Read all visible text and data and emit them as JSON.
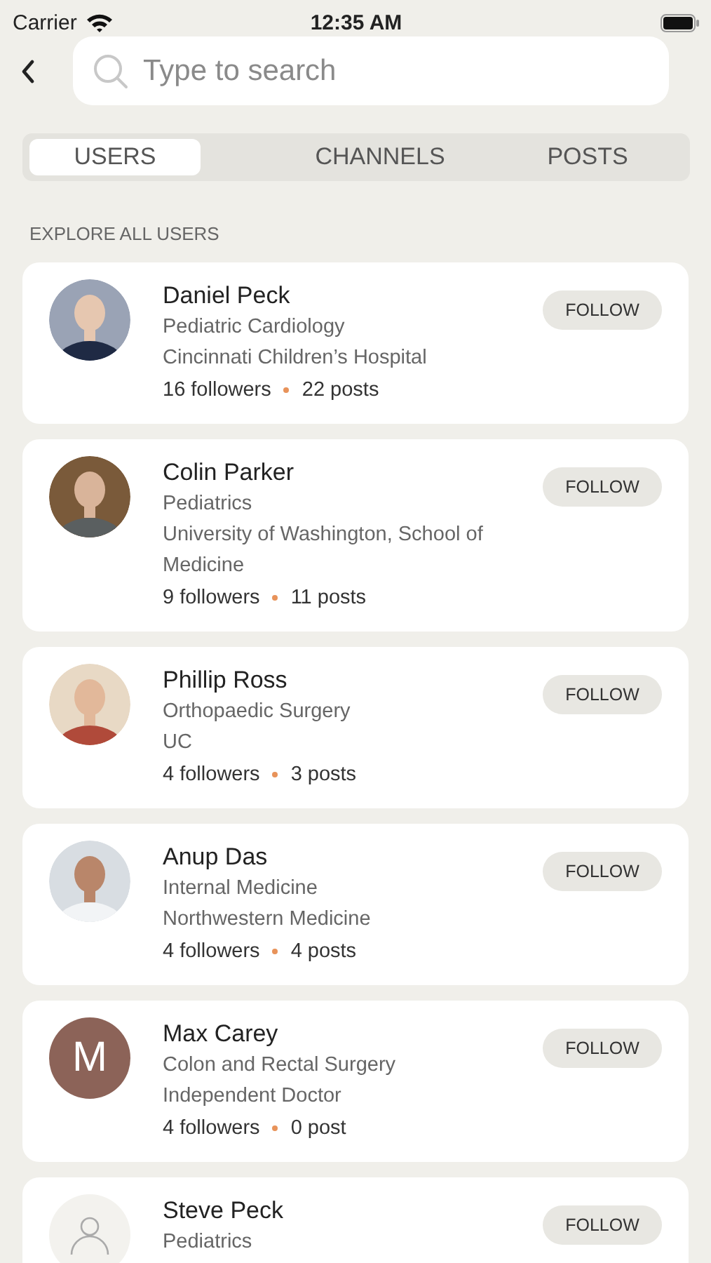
{
  "status_bar": {
    "carrier": "Carrier",
    "time": "12:35 AM"
  },
  "search": {
    "placeholder": "Type to search"
  },
  "tabs": [
    {
      "label": "USERS",
      "selected": true
    },
    {
      "label": "CHANNELS",
      "selected": false
    },
    {
      "label": "POSTS",
      "selected": false
    }
  ],
  "section_title": "EXPLORE ALL USERS",
  "users": [
    {
      "name": "Daniel Peck",
      "specialty": "Pediatric Cardiology",
      "organization": "Cincinnati Children’s Hospital",
      "followers": "16 followers",
      "posts": "22 posts",
      "follow": "FOLLOW"
    },
    {
      "name": "Colin Parker",
      "specialty": "Pediatrics",
      "organization": "University of Washington, School of Medicine",
      "followers": "9 followers",
      "posts": "11 posts",
      "follow": "FOLLOW"
    },
    {
      "name": "Phillip Ross",
      "specialty": "Orthopaedic Surgery",
      "organization": "UC",
      "followers": "4 followers",
      "posts": "3 posts",
      "follow": "FOLLOW"
    },
    {
      "name": "Anup Das",
      "specialty": "Internal Medicine",
      "organization": "Northwestern Medicine",
      "followers": "4 followers",
      "posts": "4 posts",
      "follow": "FOLLOW"
    },
    {
      "name": "Max Carey",
      "specialty": "Colon and Rectal Surgery",
      "organization": "Independent Doctor",
      "followers": "4 followers",
      "posts": "0 post",
      "follow": "FOLLOW",
      "avatar": {
        "kind": "initial",
        "initial": "M"
      }
    },
    {
      "name": "Steve Peck",
      "specialty": "Pediatrics",
      "follow": "FOLLOW",
      "avatar": {
        "kind": "placeholder"
      }
    }
  ]
}
